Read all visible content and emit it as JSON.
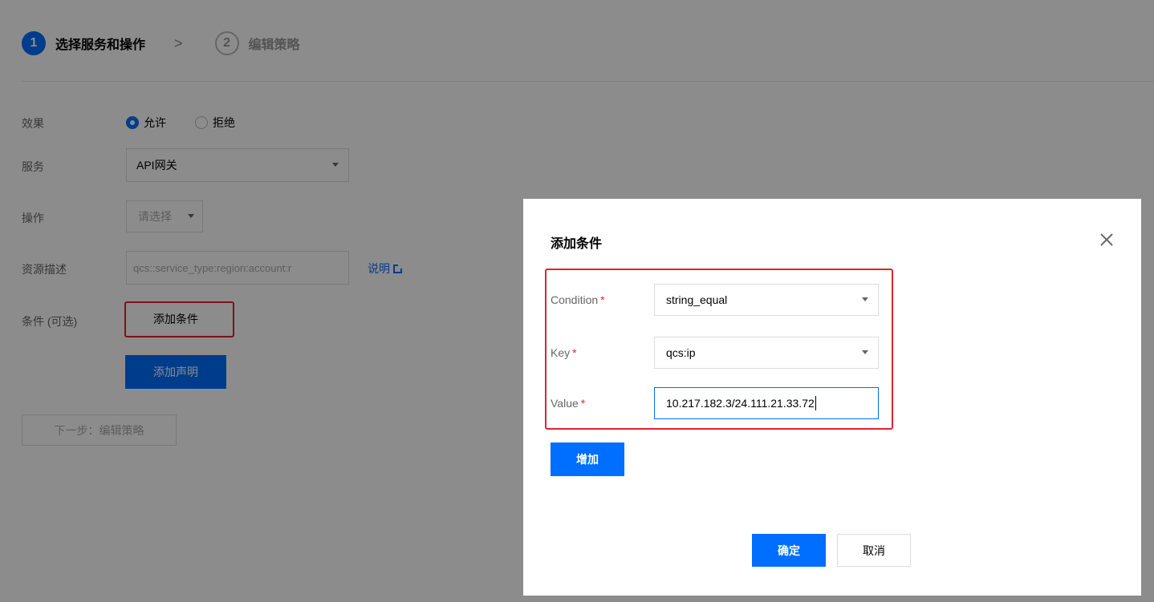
{
  "steps": [
    {
      "num": "1",
      "label": "选择服务和操作"
    },
    {
      "num": "2",
      "label": "编辑策略"
    }
  ],
  "step_arrow": ">",
  "form": {
    "effect_label": "效果",
    "effect_allow": "允许",
    "effect_deny": "拒绝",
    "service_label": "服务",
    "service_value": "API网关",
    "action_label": "操作",
    "action_value": "请选择",
    "resource_label": "资源描述",
    "resource_value": "qcs::service_type:region:account:r",
    "resource_help": "说明",
    "condition_label": "条件 (可选)",
    "add_condition": "添加条件",
    "add_statement": "添加声明",
    "next_step": "下一步：编辑策略"
  },
  "modal": {
    "title": "添加条件",
    "condition_label": "Condition",
    "condition_value": "string_equal",
    "key_label": "Key",
    "key_value": "qcs:ip",
    "value_label": "Value",
    "value_value": "10.217.182.3/24.111.21.33.72",
    "required_mark": "*",
    "add_button": "增加",
    "confirm_button": "确定",
    "cancel_button": "取消"
  },
  "colors": {
    "primary": "#006eff",
    "highlight": "#e0242c"
  }
}
